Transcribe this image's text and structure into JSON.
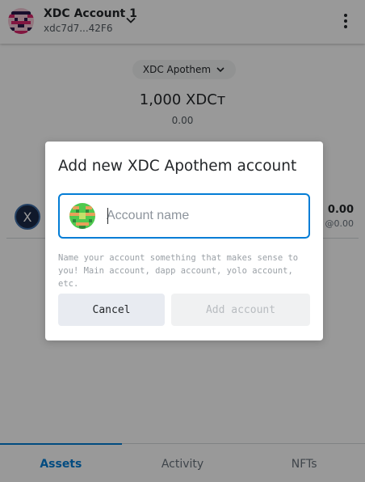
{
  "header": {
    "account_name": "XDC Account 1",
    "account_address": "xdc7d7...42F6"
  },
  "network": {
    "label": "XDC Apothem"
  },
  "balance": {
    "primary": "1,000 XDCт",
    "secondary": "0.00"
  },
  "asset": {
    "icon_letter": "X",
    "amount": "0.00",
    "fiat": "@0.00"
  },
  "tabs": [
    {
      "label": "Assets"
    },
    {
      "label": "Activity"
    },
    {
      "label": "NFTs"
    }
  ],
  "modal": {
    "title": "Add new XDC Apothem account",
    "input_value": "",
    "input_placeholder": "Account name",
    "helper_text": "Name your account something that makes sense to you! Main account, dapp account, yolo account, etc.",
    "cancel_label": "Cancel",
    "add_label": "Add account"
  },
  "colors": {
    "accent": "#037dd6",
    "overlay": "rgba(0,0,0,0.4)",
    "disabled_button_bg": "#f0f1f2",
    "cancel_button_bg": "#e8ebf1"
  },
  "icons": [
    "account-avatar-icon",
    "chevron-down-icon",
    "kebab-menu-icon",
    "xdc-token-icon",
    "identicon-icon"
  ]
}
